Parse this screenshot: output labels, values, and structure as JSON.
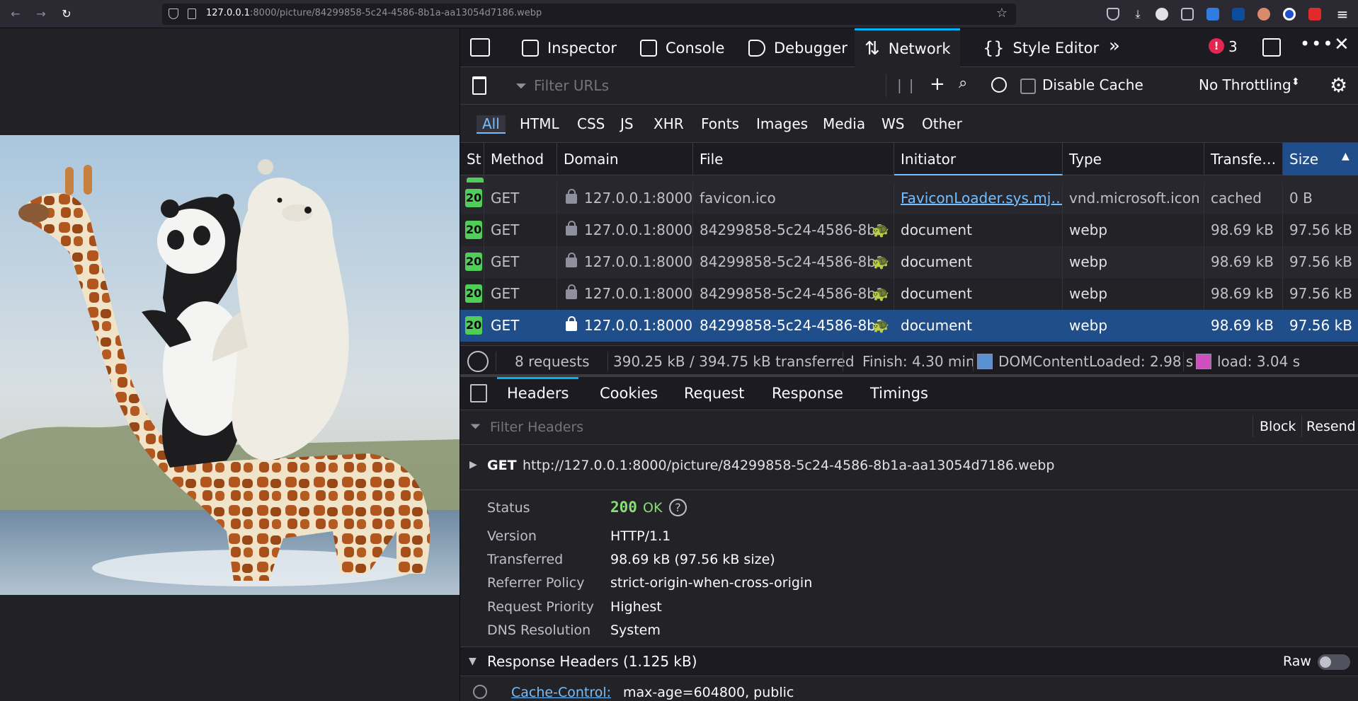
{
  "browser": {
    "url_host": "127.0.0.1",
    "url_path": ":8000/picture/84299858-5c24-4586-8b1a-aa13054d7186.webp"
  },
  "devtools": {
    "tabs": [
      {
        "label": "Inspector"
      },
      {
        "label": "Console"
      },
      {
        "label": "Debugger"
      },
      {
        "label": "Network"
      },
      {
        "label": "Style Editor"
      }
    ],
    "error_count": "3",
    "filter_placeholder": "Filter URLs",
    "disable_cache_label": "Disable Cache",
    "throttling": "No Throttling",
    "type_filters": [
      "All",
      "HTML",
      "CSS",
      "JS",
      "XHR",
      "Fonts",
      "Images",
      "Media",
      "WS",
      "Other"
    ],
    "columns": [
      "St",
      "Method",
      "Domain",
      "File",
      "Initiator",
      "Type",
      "Transfe…",
      "Size"
    ],
    "rows": [
      {
        "status": "200",
        "method": "GET",
        "domain": "127.0.0.1:8000",
        "file": "favicon.ico",
        "initiator": "FaviconLoader.sys.mj…",
        "type": "vnd.microsoft.icon",
        "transferred": "cached",
        "size": "0 B"
      },
      {
        "status": "200",
        "method": "GET",
        "domain": "127.0.0.1:8000",
        "file": "84299858-5c24-4586-8b1",
        "initiator": "document",
        "type": "webp",
        "transferred": "98.69 kB",
        "size": "97.56 kB"
      },
      {
        "status": "200",
        "method": "GET",
        "domain": "127.0.0.1:8000",
        "file": "84299858-5c24-4586-8b1",
        "initiator": "document",
        "type": "webp",
        "transferred": "98.69 kB",
        "size": "97.56 kB"
      },
      {
        "status": "200",
        "method": "GET",
        "domain": "127.0.0.1:8000",
        "file": "84299858-5c24-4586-8b1",
        "initiator": "document",
        "type": "webp",
        "transferred": "98.69 kB",
        "size": "97.56 kB"
      },
      {
        "status": "200",
        "method": "GET",
        "domain": "127.0.0.1:8000",
        "file": "84299858-5c24-4586-8b1",
        "initiator": "document",
        "type": "webp",
        "transferred": "98.69 kB",
        "size": "97.56 kB"
      }
    ],
    "summary": {
      "requests": "8 requests",
      "transferred": "390.25 kB / 394.75 kB transferred",
      "finish": "Finish: 4.30 min",
      "domcontentloaded": "DOMContentLoaded: 2.98 s",
      "load": "load: 3.04 s"
    },
    "detail_tabs": [
      "Headers",
      "Cookies",
      "Request",
      "Response",
      "Timings"
    ],
    "filter_headers_placeholder": "Filter Headers",
    "block_label": "Block",
    "resend_label": "Resend",
    "request_method": "GET",
    "request_url": "http://127.0.0.1:8000/picture/84299858-5c24-4586-8b1a-aa13054d7186.webp",
    "info": {
      "status_label": "Status",
      "status_code": "200",
      "status_text": "OK",
      "version_label": "Version",
      "version": "HTTP/1.1",
      "transferred_label": "Transferred",
      "transferred": "98.69 kB (97.56 kB size)",
      "referrer_label": "Referrer Policy",
      "referrer": "strict-origin-when-cross-origin",
      "priority_label": "Request Priority",
      "priority": "Highest",
      "dns_label": "DNS Resolution",
      "dns": "System"
    },
    "response_headers_label": "Response Headers (1.125 kB)",
    "raw_label": "Raw",
    "cache_control_name": "Cache-Control:",
    "cache_control_value": "max-age=604800, public"
  }
}
